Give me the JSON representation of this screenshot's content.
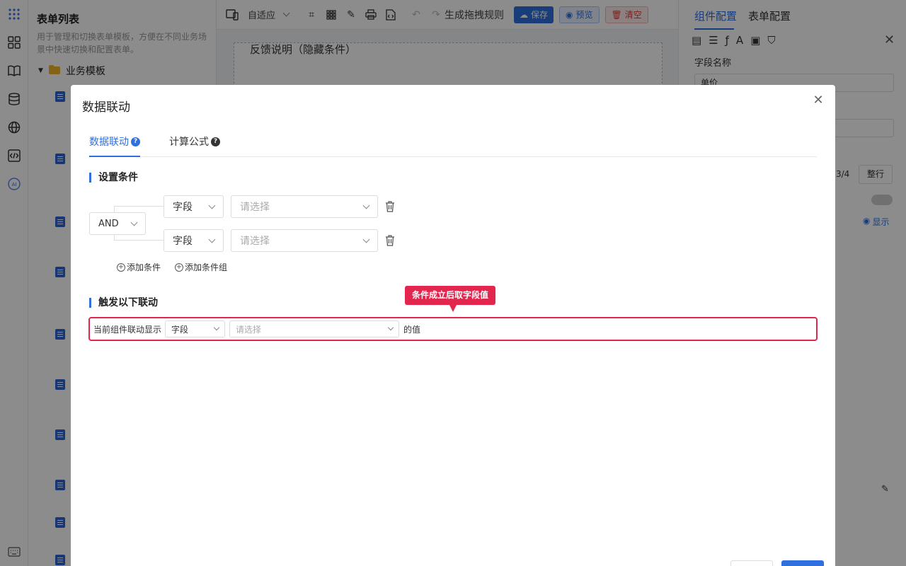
{
  "colors": {
    "primary": "#2f6fde",
    "danger": "#e3264d",
    "overlay": "rgba(0,0,0,0.45)"
  },
  "sidebar": {
    "icons": [
      "apps-icon",
      "grid-icon",
      "book-icon",
      "database-icon",
      "globe-icon",
      "code-icon",
      "ai-icon",
      "keyboard-icon"
    ]
  },
  "list_panel": {
    "title": "表单列表",
    "description": "用于管理和切换表单模板，方便在不同业务场景中快速切换和配置表单。",
    "folder_label": "业务模板"
  },
  "toolbar": {
    "adaptive_label": "自适应",
    "generate_rules_label": "生成拖拽规则",
    "save_label": "保存",
    "preview_label": "预览",
    "clear_label": "清空"
  },
  "canvas": {
    "visible_text": "反馈说明（隐藏条件）"
  },
  "right_panel": {
    "tabs": [
      "组件配置",
      "表单配置"
    ],
    "field_name_label": "字段名称",
    "field_name_value": "单价",
    "ratio_value": "3/4",
    "full_row_label": "整行",
    "show_label": "显示"
  },
  "modal": {
    "title": "数据联动",
    "tabs": [
      {
        "label": "数据联动",
        "active": true
      },
      {
        "label": "计算公式",
        "active": false
      }
    ],
    "conditions": {
      "section_title": "设置条件",
      "logic_operator": "AND",
      "rows": [
        {
          "field_type": "字段",
          "placeholder": "请选择"
        },
        {
          "field_type": "字段",
          "placeholder": "请选择"
        }
      ],
      "add_condition_label": "添加条件",
      "add_group_label": "添加条件组"
    },
    "trigger": {
      "section_title": "触发以下联动",
      "tooltip": "条件成立后取字段值",
      "prefix": "当前组件联动显示",
      "field_type": "字段",
      "placeholder": "请选择",
      "suffix": "的值"
    }
  }
}
